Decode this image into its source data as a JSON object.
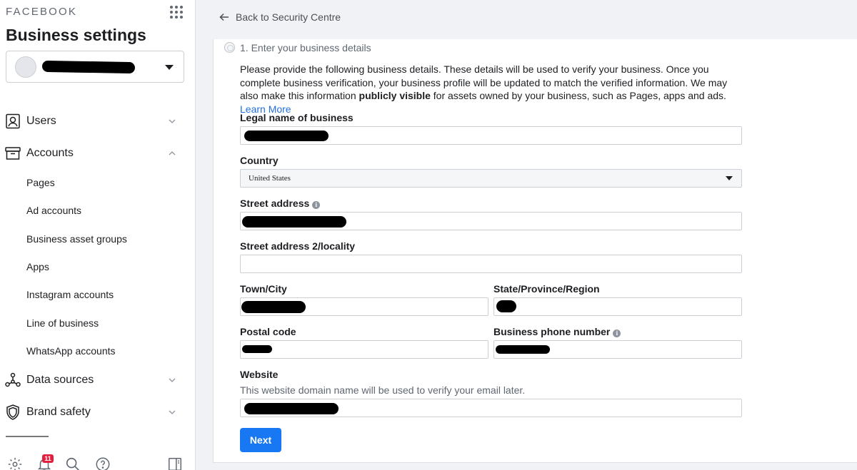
{
  "sidebar": {
    "brand": "FACEBOOK",
    "title": "Business settings",
    "nav": {
      "users": "Users",
      "accounts": "Accounts",
      "data_sources": "Data sources",
      "brand_safety": "Brand safety"
    },
    "accounts_sub": [
      "Pages",
      "Ad accounts",
      "Business asset groups",
      "Apps",
      "Instagram accounts",
      "Line of business",
      "WhatsApp accounts"
    ],
    "notification_count": "11"
  },
  "main": {
    "back_label": "Back to Security Centre",
    "step_title": "1. Enter your business details",
    "intro": {
      "part1": "Please provide the following business details. These details will be used to verify your business. Once you complete business verification, your business profile will be updated to match the verified information. We may also make this information ",
      "bold": "publicly visible",
      "part2": " for assets owned by your business, such as Pages, apps and ads. ",
      "link": "Learn More"
    },
    "fields": {
      "legal_name": "Legal name of business",
      "country": "Country",
      "country_value": "United States",
      "street": "Street address",
      "street2": "Street address 2/locality",
      "town": "Town/City",
      "state": "State/Province/Region",
      "postal": "Postal code",
      "phone": "Business phone number",
      "website": "Website",
      "website_hint": "This website domain name will be used to verify your email later."
    },
    "next_label": "Next"
  },
  "colors": {
    "primary_button": "#1877f2",
    "link": "#216fdb",
    "badge": "#e41e3f"
  },
  "icons": [
    "users-icon",
    "accounts-icon",
    "data-sources-icon",
    "brand-safety-icon",
    "settings-icon",
    "notifications-icon",
    "search-icon",
    "help-icon",
    "panel-icon",
    "back-arrow-icon",
    "info-icon"
  ]
}
